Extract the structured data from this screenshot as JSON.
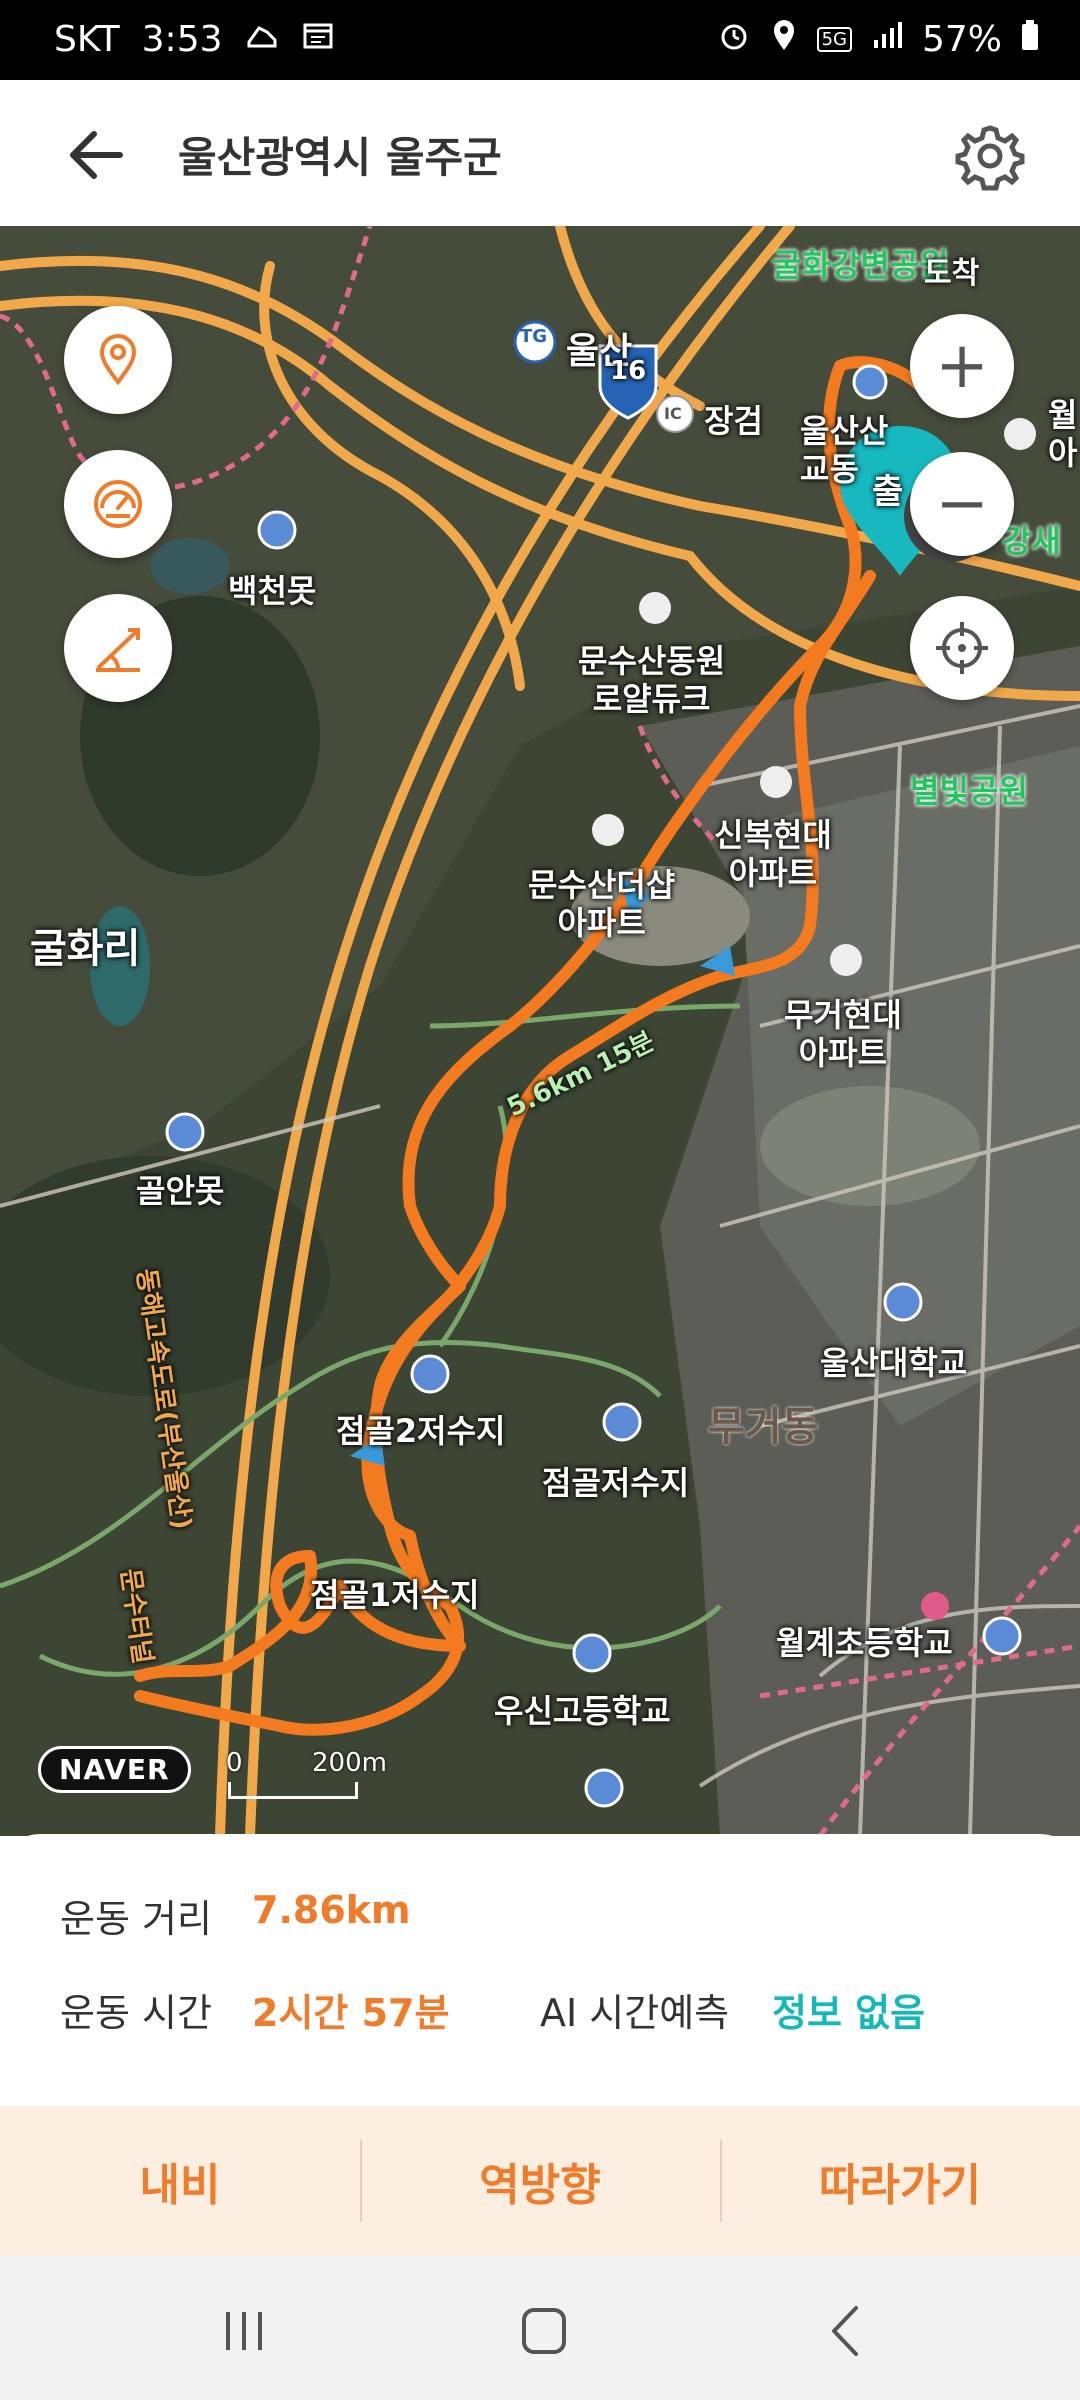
{
  "status_bar": {
    "carrier": "SKT",
    "time": "3:53",
    "network": "5G",
    "battery": "57%"
  },
  "header": {
    "title": "울산광역시 울주군"
  },
  "map": {
    "labels": {
      "gulhwa_riverside": "굴화강변공원",
      "ulsan_tg": "울산",
      "tg_badge": "TG",
      "route_16": "16",
      "ic_badge": "IC",
      "janggeom": "장검",
      "baekcheonmot": "백천못",
      "munsusan_royal": "문수산동원\n로얄듀크",
      "sinbok_apt": "신복현대\n아파트",
      "munsusan_apt": "문수산더샵\n아파트",
      "gulhwari": "굴화리",
      "mugeo_apt": "무거현대\n아파트",
      "walk_time": "5.6km 15분",
      "golanmot": "골안못",
      "expressway": "동해고속도로(부산울산)",
      "ulsan_univ": "울산대학교",
      "jeomgol2": "점골2저수지",
      "jeomgol_res": "점골저수지",
      "mugeodong": "무거동",
      "jeomgol1": "점골1저수지",
      "munsu_tunnel": "문수터널",
      "wolgye_school": "월계초등학교",
      "usin_high": "우신고등학교",
      "byeolbit_park": "별빛공원",
      "wolgye_apt": "월\n아",
      "yangsae": "강새",
      "ulsan_apt_partial": "울산산\n교동",
      "arrival_pin": "도착",
      "start_pin": "출"
    },
    "naver_logo": "NAVER",
    "scale": {
      "zero": "0",
      "distance": "200m"
    },
    "controls": {
      "zoom_in": "+",
      "zoom_out": "−"
    }
  },
  "stats": {
    "distance_label": "운동 거리",
    "distance_value": "7.86km",
    "time_label": "운동 시간",
    "time_value": "2시간 57분",
    "ai_label": "AI 시간예측",
    "ai_value": "정보 없음"
  },
  "actions": {
    "navigate": "내비",
    "reverse": "역방향",
    "follow": "따라가기"
  },
  "colors": {
    "route": "#f47a20",
    "accent": "#f07c2a",
    "teal": "#14b8b8",
    "action_bg": "#fdeee2"
  }
}
